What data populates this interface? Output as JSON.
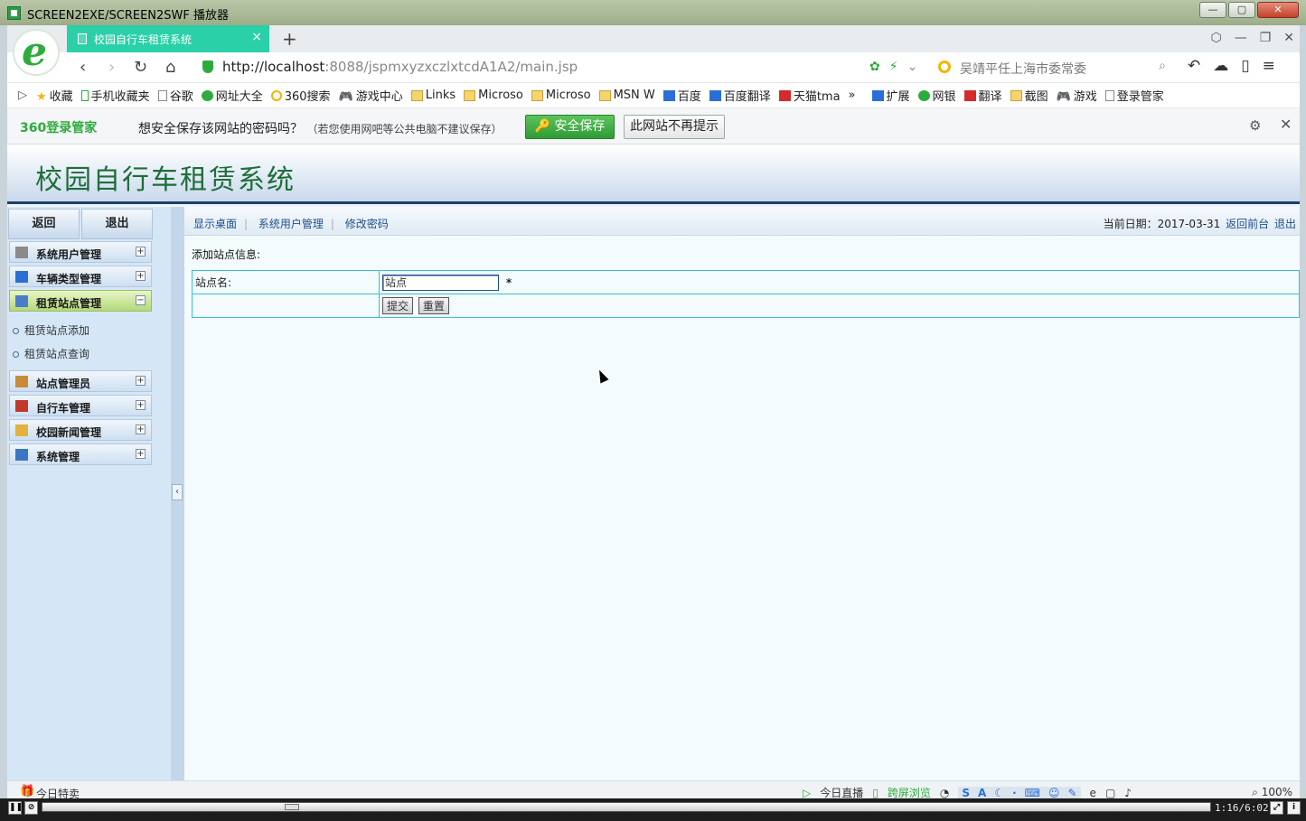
{
  "window": {
    "title": "SCREEN2EXE/SCREEN2SWF 播放器",
    "buttons": {
      "minimize": "—",
      "maximize": "▢",
      "close": "✕"
    }
  },
  "browser": {
    "tab": {
      "title": "校园自行车租赁系统",
      "close": "×"
    },
    "new_tab": "+",
    "url": {
      "host": "http://localhost",
      "rest": ":8088/jspmxyzxczlxtcdA1A2/main.jsp"
    },
    "search_placeholder": "吴靖平任上海市委常委",
    "favorites": [
      {
        "label": "收藏",
        "icon": "star"
      },
      {
        "label": "手机收藏夹",
        "icon": "phone"
      },
      {
        "label": "谷歌",
        "icon": "doc"
      },
      {
        "label": "网址大全",
        "icon": "green"
      },
      {
        "label": "360搜索",
        "icon": "ring"
      },
      {
        "label": "游戏中心",
        "icon": "pad"
      },
      {
        "label": "Links",
        "icon": "folder"
      },
      {
        "label": "Microso",
        "icon": "folder"
      },
      {
        "label": "Microso",
        "icon": "folder"
      },
      {
        "label": "MSN W",
        "icon": "folder"
      },
      {
        "label": "百度",
        "icon": "blue"
      },
      {
        "label": "百度翻译",
        "icon": "blue"
      },
      {
        "label": "天猫tma",
        "icon": "red"
      },
      {
        "label": "»",
        "icon": ""
      },
      {
        "label": "扩展",
        "icon": "blue"
      },
      {
        "label": "网银",
        "icon": "green"
      },
      {
        "label": "翻译",
        "icon": "red"
      },
      {
        "label": "截图",
        "icon": "folder"
      },
      {
        "label": "游戏",
        "icon": "pad"
      },
      {
        "label": "登录管家",
        "icon": "doc"
      }
    ],
    "password_prompt": {
      "brand": "360登录管家",
      "question": "想安全保存该网站的密码吗？",
      "note": "（若您使用网吧等公共电脑不建议保存）",
      "save_button": "安全保存",
      "never_button": "此网站不再提示"
    },
    "status": {
      "today_deals": "今日特卖",
      "live": "今日直播",
      "cross_screen": "跨屏浏览",
      "zoom": "100%"
    }
  },
  "app": {
    "title": "校园自行车租赁系统",
    "sidebar": {
      "back": "返回",
      "logout": "退出",
      "menus": [
        {
          "label": "系统用户管理",
          "icon": "gear-icon",
          "expanded": false
        },
        {
          "label": "车辆类型管理",
          "icon": "monitor-icon",
          "expanded": false
        },
        {
          "label": "租赁站点管理",
          "icon": "table-icon",
          "expanded": true,
          "items": [
            "租赁站点添加",
            "租赁站点查询"
          ]
        },
        {
          "label": "站点管理员",
          "icon": "user-icon",
          "expanded": false
        },
        {
          "label": "自行车管理",
          "icon": "calendar-icon",
          "expanded": false
        },
        {
          "label": "校园新闻管理",
          "icon": "folder-icon",
          "expanded": false
        },
        {
          "label": "系统管理",
          "icon": "chart-icon",
          "expanded": false
        }
      ]
    },
    "topnav": {
      "links": [
        "显示桌面",
        "系统用户管理",
        "修改密码"
      ],
      "date_label": "当前日期：2017-03-31",
      "back_front": "返回前台",
      "logout": "退出"
    },
    "form": {
      "caption": "添加站点信息:",
      "field_label": "站点名:",
      "field_value": "站点",
      "required_mark": "*",
      "submit": "提交",
      "reset": "重置"
    }
  },
  "player": {
    "time": "1:16/6:02",
    "progress": 0.21
  }
}
